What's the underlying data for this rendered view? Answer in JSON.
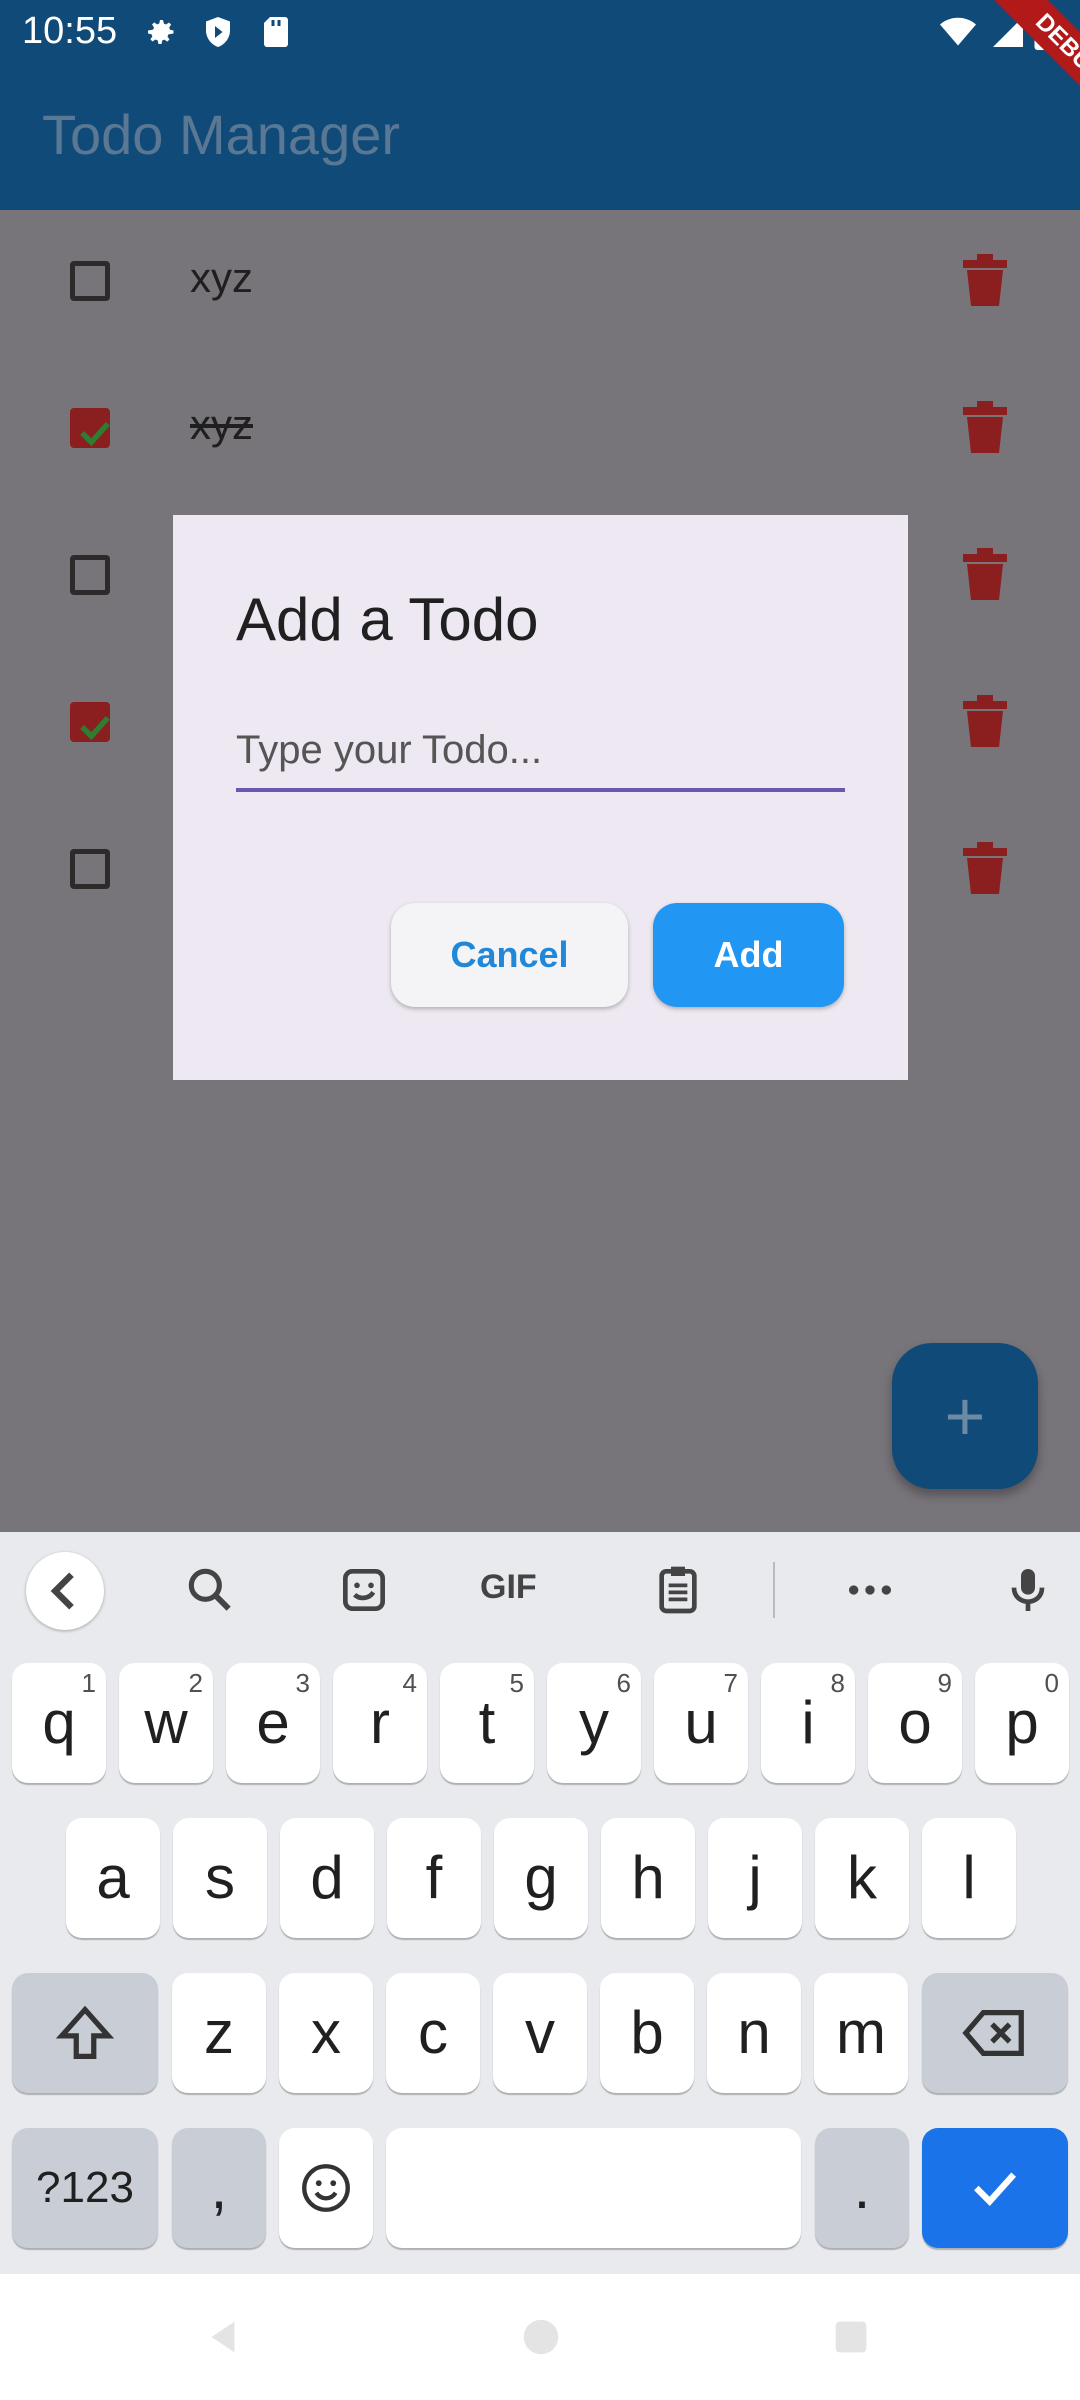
{
  "status_bar": {
    "time": "10:55"
  },
  "app_bar": {
    "title": "Todo Manager",
    "debug_label": "DEBUG"
  },
  "todos": [
    {
      "text": "xyz",
      "checked": false
    },
    {
      "text": "xyz",
      "checked": true
    },
    {
      "text": "",
      "checked": false
    },
    {
      "text": "",
      "checked": true
    },
    {
      "text": "",
      "checked": false
    }
  ],
  "dialog": {
    "title": "Add a Todo",
    "input_placeholder": "Type your Todo...",
    "cancel_label": "Cancel",
    "add_label": "Add"
  },
  "fab": {
    "label": "+"
  },
  "keyboard": {
    "toolbar": {
      "gif_label": "GIF"
    },
    "row1": [
      {
        "key": "q",
        "num": "1"
      },
      {
        "key": "w",
        "num": "2"
      },
      {
        "key": "e",
        "num": "3"
      },
      {
        "key": "r",
        "num": "4"
      },
      {
        "key": "t",
        "num": "5"
      },
      {
        "key": "y",
        "num": "6"
      },
      {
        "key": "u",
        "num": "7"
      },
      {
        "key": "i",
        "num": "8"
      },
      {
        "key": "o",
        "num": "9"
      },
      {
        "key": "p",
        "num": "0"
      }
    ],
    "row2": [
      "a",
      "s",
      "d",
      "f",
      "g",
      "h",
      "j",
      "k",
      "l"
    ],
    "row3": [
      "z",
      "x",
      "c",
      "v",
      "b",
      "n",
      "m"
    ],
    "symbols_label": "?123",
    "comma_label": ",",
    "period_label": "."
  },
  "colors": {
    "app_bar": "#0f4a78",
    "scrim": "#77747a",
    "dialog_bg": "#ede8f1",
    "add_button": "#2196f3",
    "delete_icon": "#8b1e1e",
    "keyboard_enter": "#1a73e8"
  }
}
